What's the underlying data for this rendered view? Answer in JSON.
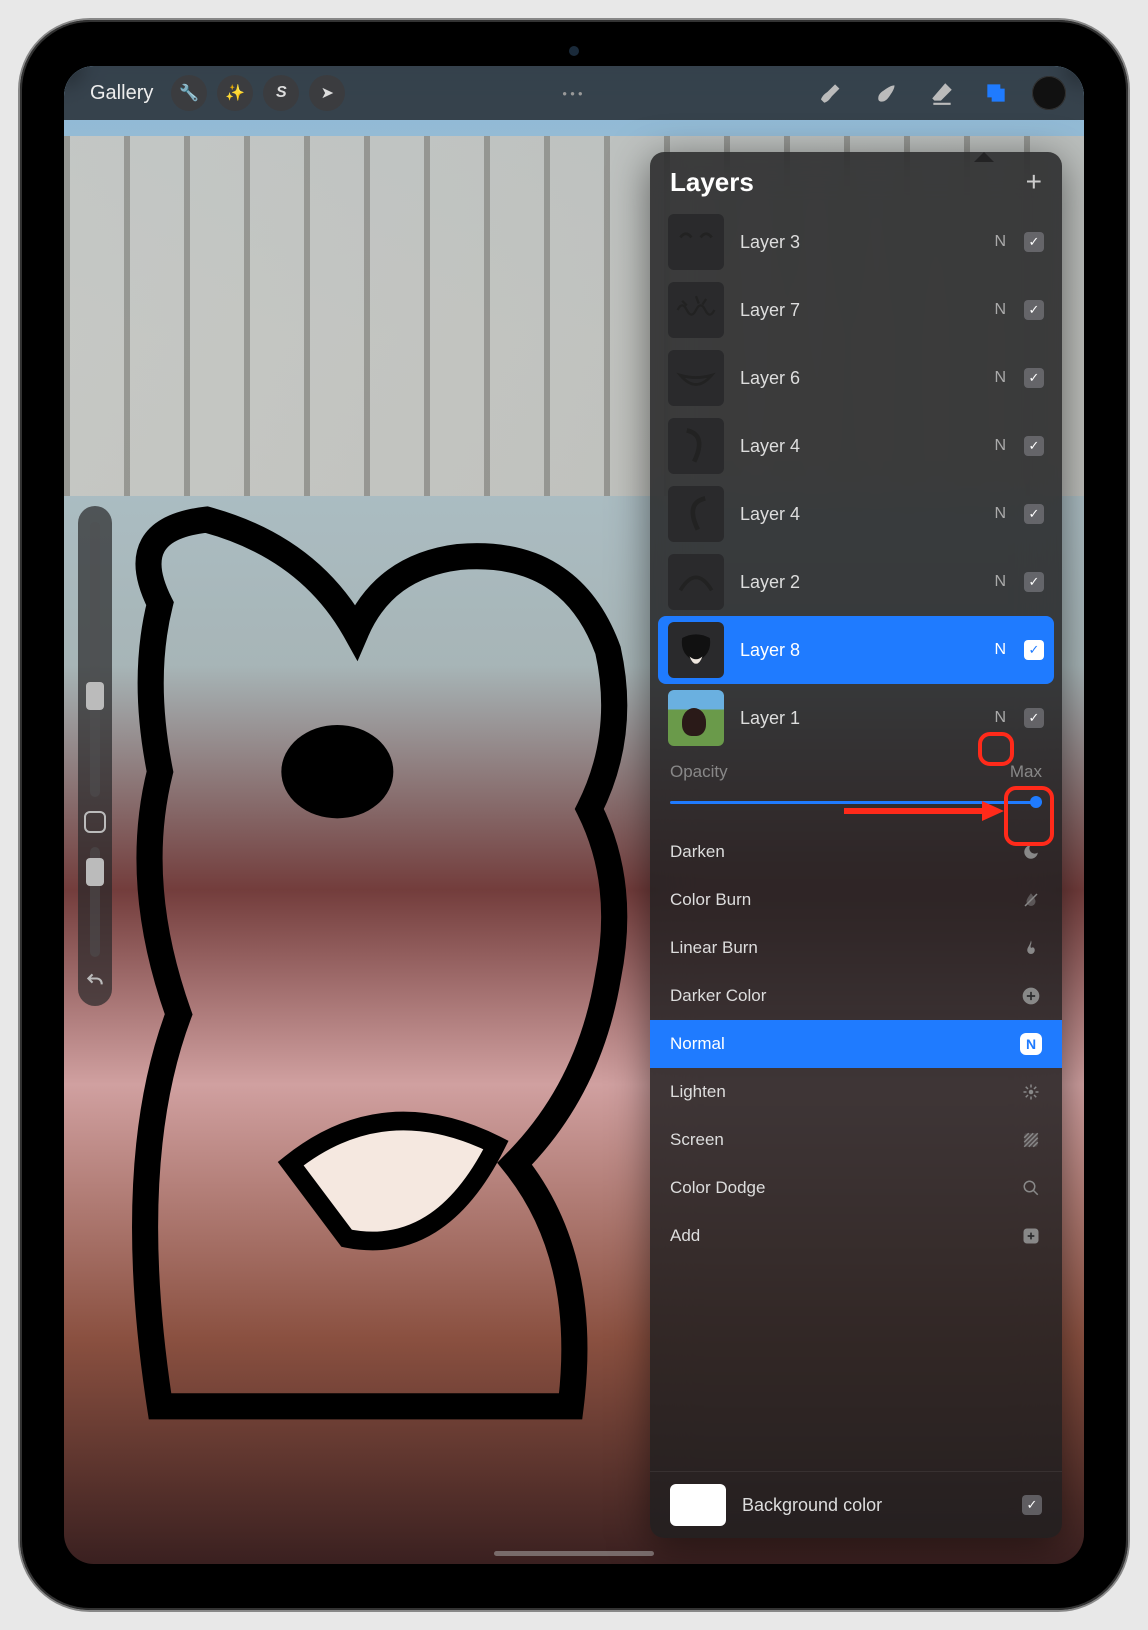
{
  "toolbar": {
    "gallery_label": "Gallery"
  },
  "layers_panel": {
    "title": "Layers",
    "opacity_label": "Opacity",
    "opacity_value": "Max",
    "background_label": "Background color",
    "layers": [
      {
        "name": "Layer 3",
        "blend": "N",
        "visible": true,
        "selected": false,
        "thumb": "eyes"
      },
      {
        "name": "Layer 7",
        "blend": "N",
        "visible": true,
        "selected": false,
        "thumb": "scribble"
      },
      {
        "name": "Layer 6",
        "blend": "N",
        "visible": true,
        "selected": false,
        "thumb": "mouth"
      },
      {
        "name": "Layer 4",
        "blend": "N",
        "visible": true,
        "selected": false,
        "thumb": "curve1"
      },
      {
        "name": "Layer 4",
        "blend": "N",
        "visible": true,
        "selected": false,
        "thumb": "curve2"
      },
      {
        "name": "Layer 2",
        "blend": "N",
        "visible": true,
        "selected": false,
        "thumb": "arc"
      },
      {
        "name": "Layer 8",
        "blend": "N",
        "visible": true,
        "selected": true,
        "thumb": "blob"
      },
      {
        "name": "Layer 1",
        "blend": "N",
        "visible": true,
        "selected": false,
        "thumb": "photo"
      }
    ],
    "blend_modes": [
      {
        "label": "Darken",
        "selected": false,
        "icon": "moon"
      },
      {
        "label": "Color Burn",
        "selected": false,
        "icon": "drop-off"
      },
      {
        "label": "Linear Burn",
        "selected": false,
        "icon": "flame"
      },
      {
        "label": "Darker Color",
        "selected": false,
        "icon": "plus-circle"
      },
      {
        "label": "Normal",
        "selected": true,
        "icon": "n-badge"
      },
      {
        "label": "Lighten",
        "selected": false,
        "icon": "burst"
      },
      {
        "label": "Screen",
        "selected": false,
        "icon": "hatch"
      },
      {
        "label": "Color Dodge",
        "selected": false,
        "icon": "lens"
      },
      {
        "label": "Add",
        "selected": false,
        "icon": "plus-square"
      }
    ]
  }
}
